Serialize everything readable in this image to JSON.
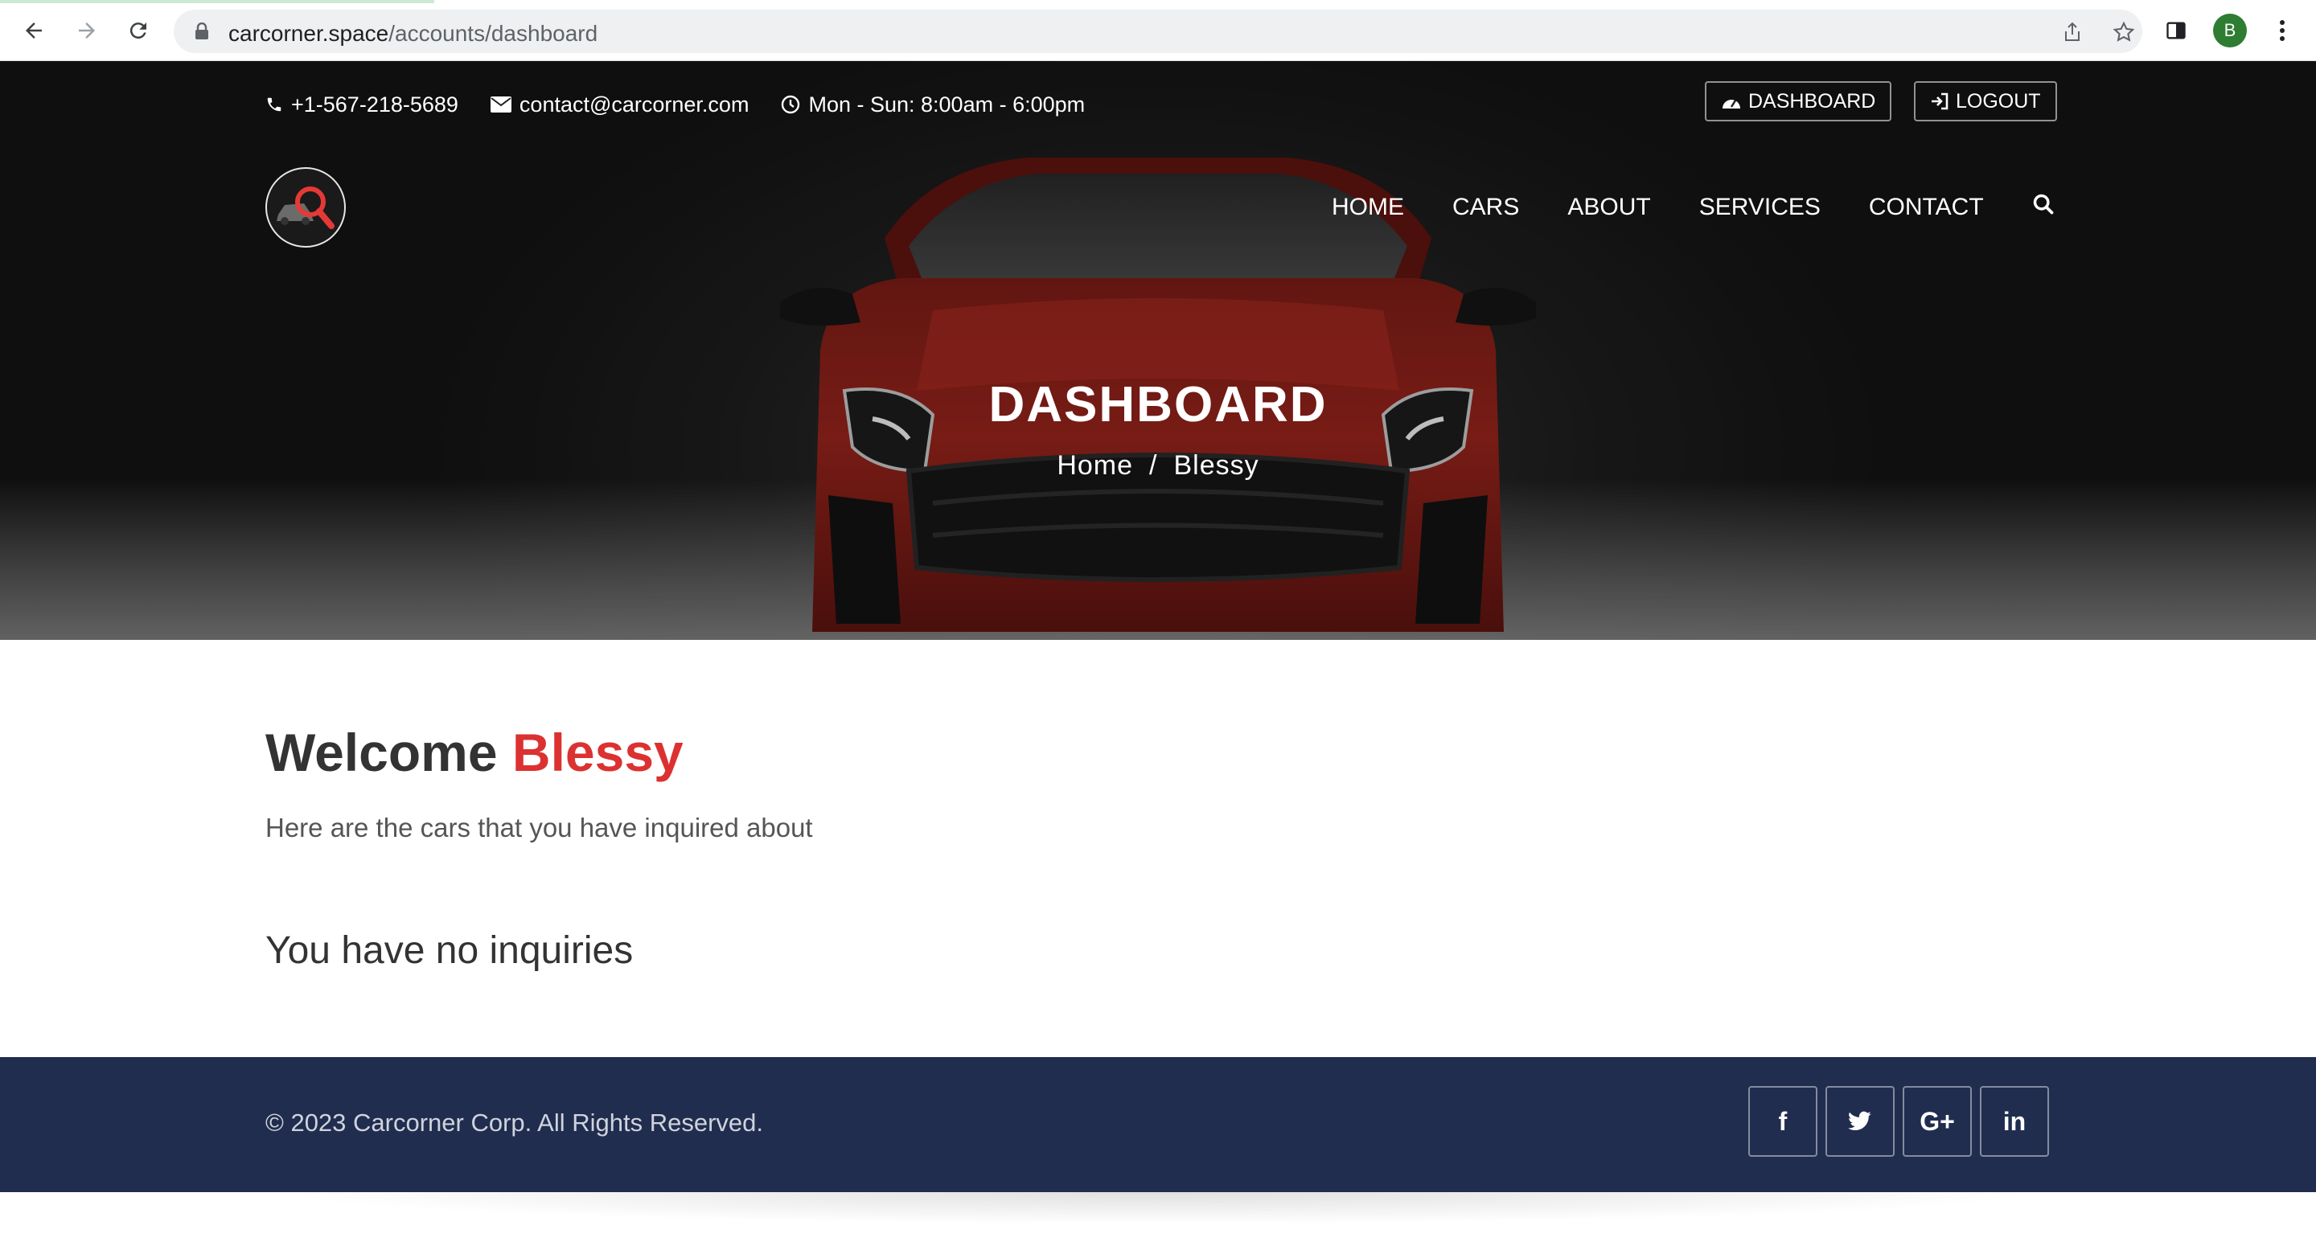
{
  "browser": {
    "url_host": "carcorner.space",
    "url_path": "/accounts/dashboard",
    "avatar_initial": "B"
  },
  "topbar": {
    "phone": "+1-567-218-5689",
    "email": "contact@carcorner.com",
    "hours": "Mon - Sun: 8:00am - 6:00pm",
    "dashboard_label": "DASHBOARD",
    "logout_label": "LOGOUT"
  },
  "nav": {
    "items": [
      "HOME",
      "CARS",
      "ABOUT",
      "SERVICES",
      "CONTACT"
    ]
  },
  "hero": {
    "title": "DASHBOARD",
    "breadcrumb_home": "Home",
    "breadcrumb_sep": "/",
    "breadcrumb_current": "Blessy"
  },
  "main": {
    "welcome_prefix": "Welcome",
    "welcome_name": "Blessy",
    "subtitle": "Here are the cars that you have inquired about",
    "empty_message": "You have no inquiries"
  },
  "footer": {
    "copyright": "© 2023 Carcorner Corp. All Rights Reserved.",
    "social": [
      "f",
      "twitter",
      "G+",
      "in"
    ]
  },
  "colors": {
    "accent_red": "#dc3131",
    "footer_navy": "#212d4f"
  }
}
